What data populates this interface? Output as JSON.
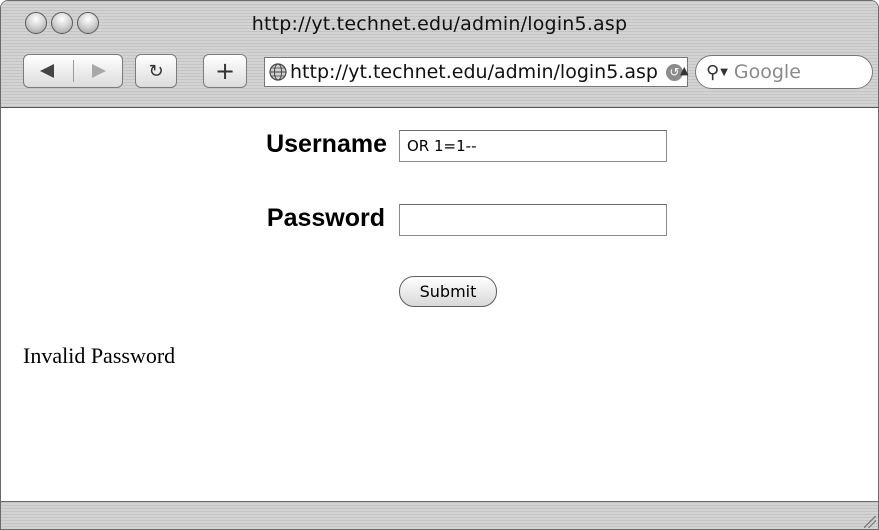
{
  "window": {
    "title": "http://yt.technet.edu/admin/login5.asp"
  },
  "toolbar": {
    "back_icon": "back-arrow-icon",
    "forward_icon": "forward-arrow-icon",
    "reload_glyph": "↻",
    "add_glyph": "+",
    "url": "http://yt.technet.edu/admin/login5.asp",
    "search_placeholder": "Google"
  },
  "form": {
    "username_label": "Username",
    "username_value": "OR 1=1--",
    "password_label": "Password",
    "password_value": "",
    "submit_label": "Submit"
  },
  "message": "Invalid Password"
}
